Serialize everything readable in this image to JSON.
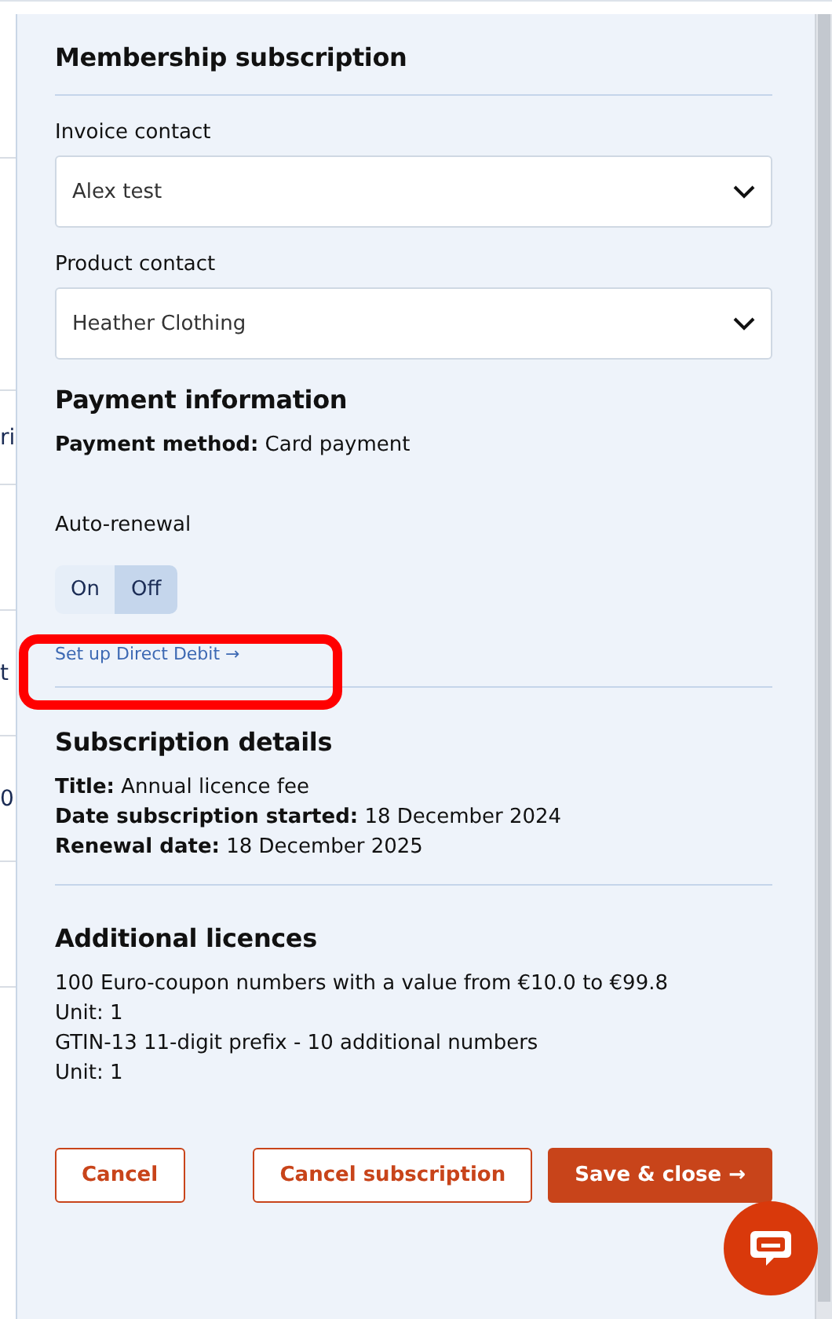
{
  "background_fragments": [
    "ri",
    "t",
    "0"
  ],
  "panel": {
    "title": "Membership subscription",
    "contacts": [
      {
        "label": "Invoice contact",
        "value": "Alex test"
      },
      {
        "label": "Product contact",
        "value": "Heather Clothing"
      }
    ],
    "payment": {
      "heading": "Payment information",
      "method_label": "Payment method:",
      "method_value": "Card payment",
      "auto_renewal": {
        "label": "Auto-renewal",
        "options": [
          {
            "label": "On",
            "selected": false
          },
          {
            "label": "Off",
            "selected": true
          }
        ]
      },
      "link": {
        "text": "Set up Direct Debit →",
        "highlighted": true
      }
    },
    "subscription": {
      "heading": "Subscription details",
      "fields": [
        {
          "label": "Title:",
          "value": "Annual licence fee"
        },
        {
          "label": "Date subscription started:",
          "value": "18 December 2024"
        },
        {
          "label": "Renewal date:",
          "value": "18 December 2025"
        }
      ]
    },
    "licences": {
      "heading": "Additional licences",
      "lines": [
        "100 Euro-coupon numbers with a value from €10.0 to €99.8",
        "Unit: 1",
        "GTIN-13 11-digit prefix - 10 additional numbers",
        "Unit: 1"
      ]
    },
    "buttons": [
      {
        "label": "Cancel",
        "kind": "outline"
      },
      {
        "label": "Cancel subscription",
        "kind": "outline"
      },
      {
        "label": "Save & close →",
        "kind": "primary"
      }
    ]
  }
}
